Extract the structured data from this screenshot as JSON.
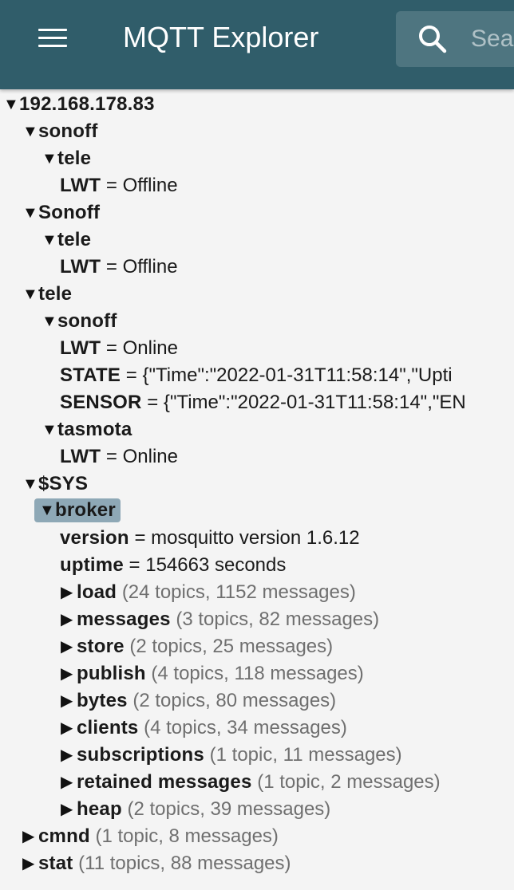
{
  "app": {
    "title": "MQTT Explorer"
  },
  "search": {
    "placeholder": "Search"
  },
  "tree": {
    "n0": {
      "name": "192.168.178.83"
    },
    "n1": {
      "name": "sonoff"
    },
    "n2": {
      "name": "tele"
    },
    "n3": {
      "name": "LWT",
      "value": "Offline"
    },
    "n4": {
      "name": "Sonoff"
    },
    "n5": {
      "name": "tele"
    },
    "n6": {
      "name": "LWT",
      "value": "Offline"
    },
    "n7": {
      "name": "tele"
    },
    "n8": {
      "name": "sonoff"
    },
    "n9": {
      "name": "LWT",
      "value": "Online"
    },
    "n10": {
      "name": "STATE",
      "value": "{\"Time\":\"2022-01-31T11:58:14\",\"Upti"
    },
    "n11": {
      "name": "SENSOR",
      "value": "{\"Time\":\"2022-01-31T11:58:14\",\"EN"
    },
    "n12": {
      "name": "tasmota"
    },
    "n13": {
      "name": "LWT",
      "value": "Online"
    },
    "n14": {
      "name": "$SYS"
    },
    "n15": {
      "name": "broker"
    },
    "n16": {
      "name": "version",
      "value": "mosquitto version 1.6.12"
    },
    "n17": {
      "name": "uptime",
      "value": "154663 seconds"
    },
    "n18": {
      "name": "load",
      "meta": "(24 topics, 1152 messages)"
    },
    "n19": {
      "name": "messages",
      "meta": "(3 topics, 82 messages)"
    },
    "n20": {
      "name": "store",
      "meta": "(2 topics, 25 messages)"
    },
    "n21": {
      "name": "publish",
      "meta": "(4 topics, 118 messages)"
    },
    "n22": {
      "name": "bytes",
      "meta": "(2 topics, 80 messages)"
    },
    "n23": {
      "name": "clients",
      "meta": "(4 topics, 34 messages)"
    },
    "n24": {
      "name": "subscriptions",
      "meta": "(1 topic, 11 messages)"
    },
    "n25": {
      "name": "retained messages",
      "meta": "(1 topic, 2 messages)"
    },
    "n26": {
      "name": "heap",
      "meta": "(2 topics, 39 messages)"
    },
    "n27": {
      "name": "cmnd",
      "meta": "(1 topic, 8 messages)"
    },
    "n28": {
      "name": "stat",
      "meta": "(11 topics, 88 messages)"
    }
  },
  "glyphs": {
    "expanded": "▼",
    "collapsed": "▶",
    "equals": "="
  }
}
